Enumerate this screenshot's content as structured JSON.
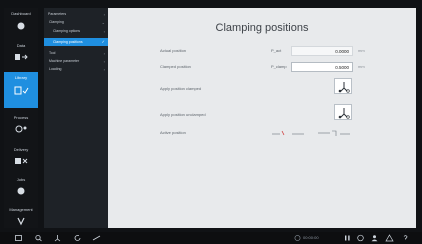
{
  "left_nav": [
    {
      "label": "Dashboard",
      "icon": "pointer-icon"
    },
    {
      "label": "Data",
      "icon": "data-transfer-icon"
    },
    {
      "label": "Library",
      "icon": "library-icon"
    },
    {
      "label": "Process",
      "icon": "process-icon"
    },
    {
      "label": "Delivery",
      "icon": "delivery-icon"
    },
    {
      "label": "Jobs",
      "icon": "jobs-icon"
    },
    {
      "label": "Management",
      "icon": "management-icon"
    }
  ],
  "submenu": [
    {
      "label": "Parameters",
      "selected": false
    },
    {
      "label": "Clamping",
      "selected": false
    },
    {
      "label": "Clamping options",
      "selected": false
    },
    {
      "label": "Clamping positions",
      "selected": true
    },
    {
      "label": "Tool",
      "selected": false
    },
    {
      "label": "Machine parameter",
      "selected": false
    },
    {
      "label": "Loading",
      "selected": false
    }
  ],
  "page": {
    "title": "Clamping positions"
  },
  "fields": [
    {
      "label": "Actual position",
      "symbol": "P_act",
      "value": "0.0000",
      "unit": "mm"
    },
    {
      "label": "Clamped position",
      "symbol": "P_clamp",
      "value": "0.5000",
      "unit": "mm"
    }
  ],
  "actions": [
    {
      "label": "Apply position clamped"
    },
    {
      "label": "Apply position unclamped"
    }
  ],
  "active_position": {
    "label": "Active position"
  },
  "taskbar": {
    "clock": "00:00:00"
  },
  "colors": {
    "accent": "#1f8fe0",
    "main_bg": "#e8eaec",
    "nav_bg": "#121417",
    "submenu_bg": "#1e2227"
  }
}
